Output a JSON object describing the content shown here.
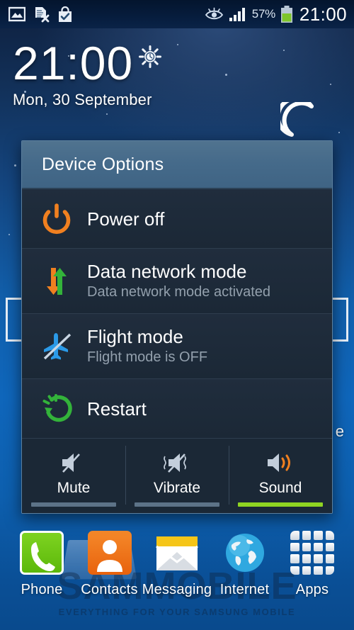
{
  "statusbar": {
    "icons": [
      {
        "name": "gallery-icon",
        "label": "Gallery"
      },
      {
        "name": "document-removed-icon",
        "label": "Document removed"
      },
      {
        "name": "play-store-update-icon",
        "label": "Play Store update"
      },
      {
        "name": "smart-stay-eye-icon",
        "label": "Smart stay"
      },
      {
        "name": "signal-bars-icon",
        "label": "Signal"
      }
    ],
    "battery_percent": "57%",
    "clock": "21:00"
  },
  "clock_widget": {
    "time": "21:00",
    "date": "Mon, 30 September",
    "weather_icon": "sun-icon"
  },
  "wallpaper": {
    "moon_icon": "crescent-moon-icon",
    "right_letter": "e"
  },
  "dialog": {
    "title": "Device Options",
    "options": [
      {
        "id": "power-off",
        "icon": "power-icon",
        "title": "Power off",
        "subtitle": "",
        "icon_color": "#f08020"
      },
      {
        "id": "data-network-mode",
        "icon": "data-transfer-arrows-icon",
        "title": "Data network mode",
        "subtitle": "Data network mode activated",
        "icon_color": "#f08020"
      },
      {
        "id": "flight-mode",
        "icon": "airplane-off-icon",
        "title": "Flight mode",
        "subtitle": "Flight mode is OFF",
        "icon_color": "#2b9ae8"
      },
      {
        "id": "restart",
        "icon": "restart-icon",
        "title": "Restart",
        "subtitle": "",
        "icon_color": "#33b33a"
      }
    ],
    "sound_modes": [
      {
        "id": "mute",
        "label": "Mute",
        "icon": "speaker-mute-icon",
        "active": false
      },
      {
        "id": "vibrate",
        "label": "Vibrate",
        "icon": "speaker-vibrate-icon",
        "active": false
      },
      {
        "id": "sound",
        "label": "Sound",
        "icon": "speaker-sound-icon",
        "active": true
      }
    ],
    "active_sound_mode": "Sound",
    "header_color": "#456a8a",
    "body_color": "#1d2a39",
    "active_bar_color": "#8fd422"
  },
  "dock": {
    "items": [
      {
        "id": "phone",
        "label": "Phone",
        "icon": "phone-handset-icon",
        "color": "#5cb80a"
      },
      {
        "id": "contacts",
        "label": "Contacts",
        "icon": "contacts-person-icon",
        "color": "#e8620d"
      },
      {
        "id": "messaging",
        "label": "Messaging",
        "icon": "envelope-icon",
        "color": "#f5c518"
      },
      {
        "id": "internet",
        "label": "Internet",
        "icon": "globe-icon",
        "color": "#29a3dd"
      },
      {
        "id": "apps",
        "label": "Apps",
        "icon": "apps-grid-icon",
        "color": "#ffffff"
      }
    ]
  },
  "watermark": {
    "main": "SAMMOBILE",
    "sub": "EVERYTHING FOR YOUR SAMSUNG MOBILE"
  }
}
